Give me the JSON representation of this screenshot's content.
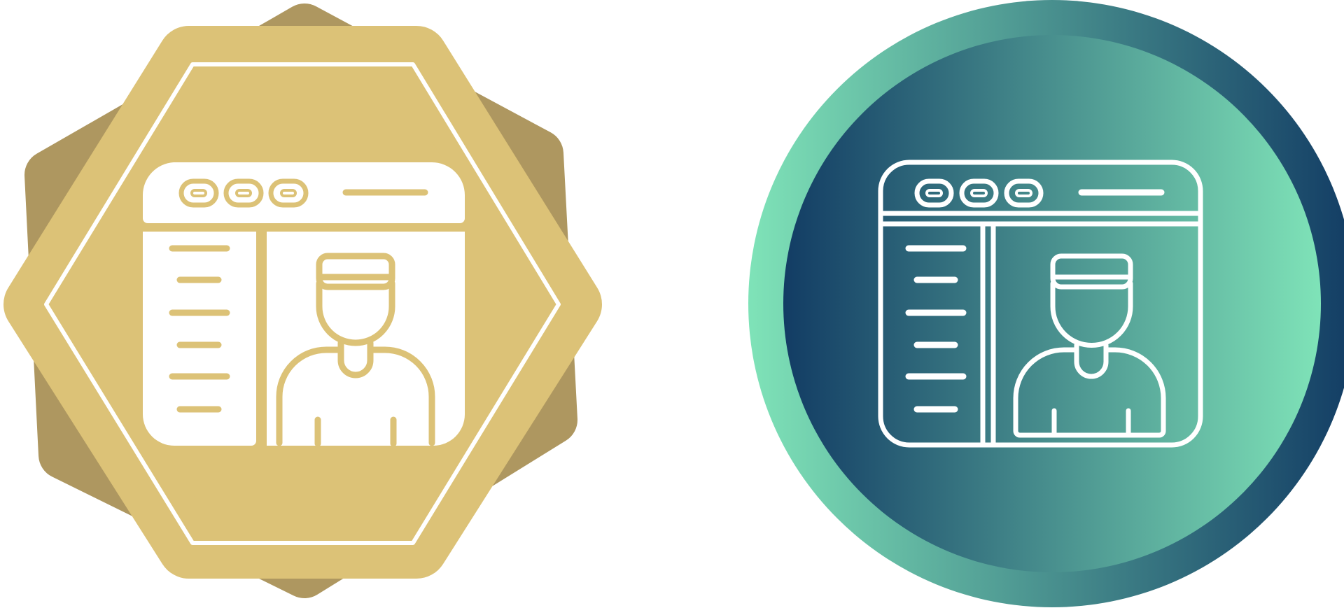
{
  "icons": [
    {
      "name": "glyph-style",
      "icon": "browser-user-profile-icon",
      "badge_shape": "octagon-seal",
      "colors": {
        "back": "#ae9760",
        "front": "#dcc277",
        "line": "#ffffff"
      }
    },
    {
      "name": "gradient-style",
      "icon": "browser-user-profile-icon",
      "badge_shape": "circle",
      "colors": {
        "outer_start": "#7fe3b8",
        "outer_end": "#123c64",
        "inner_start": "#123c64",
        "inner_end": "#7fe3b8",
        "line": "#ffffff"
      }
    }
  ]
}
